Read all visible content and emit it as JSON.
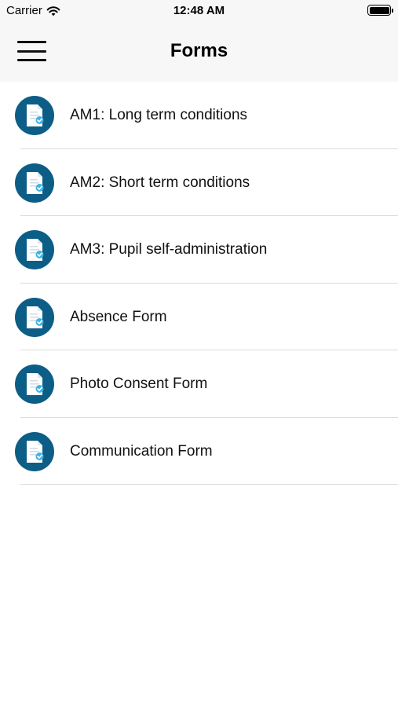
{
  "status_bar": {
    "carrier": "Carrier",
    "time": "12:48 AM",
    "wifi_icon": "wifi-icon",
    "battery_icon": "battery-icon",
    "battery_level": 1.0
  },
  "nav": {
    "title": "Forms",
    "menu_icon": "hamburger-menu-icon",
    "background": "#f7f7f7"
  },
  "forms": {
    "icon": "form-document-check-icon",
    "icon_color": "#0c5e86",
    "items": [
      {
        "label": "AM1: Long term conditions"
      },
      {
        "label": "AM2: Short term conditions"
      },
      {
        "label": "AM3: Pupil self-administration"
      },
      {
        "label": "Absence Form"
      },
      {
        "label": "Photo Consent Form"
      },
      {
        "label": "Communication Form"
      }
    ]
  }
}
